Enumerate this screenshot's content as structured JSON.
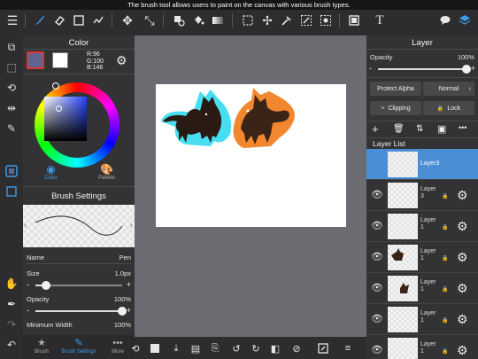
{
  "tooltip": "The brush tool allows users to paint on the canvas with various brush types.",
  "toolbar": {
    "tools": [
      "menu-icon",
      "brush-icon",
      "eraser-icon",
      "rectangle-select-icon",
      "blend-icon",
      "move-icon",
      "transform-icon",
      "fill-icon",
      "bucket-icon",
      "gradient-icon",
      "lasso-select-icon",
      "eyedropper-icon",
      "magic-wand-icon",
      "pen-select-icon",
      "text-icon",
      "speech-bubble-icon",
      "layers-icon"
    ]
  },
  "color_panel": {
    "title": "Color",
    "r": "R:96",
    "g": "G:100",
    "b": "B:146",
    "fg_color": "#606492",
    "bg_color": "#ffffff",
    "tab_color": "Color",
    "tab_palette": "Palette"
  },
  "brush_settings": {
    "title": "Brush Settings",
    "name_label": "Name",
    "name_value": "Pen",
    "size_label": "Size",
    "size_value": "1.0px",
    "size_fraction": 0.12,
    "opacity_label": "Opacity",
    "opacity_value": "100%",
    "opacity_fraction": 1.0,
    "minwidth_label": "Minimum Width",
    "minwidth_value": "100%"
  },
  "bottom_tabs": {
    "brush": "Brush",
    "brush_settings": "Brush Settings",
    "more": "More"
  },
  "layer_panel": {
    "title": "Layer",
    "opacity_label": "Opacity",
    "opacity_value": "100%",
    "opacity_fraction": 1.0,
    "protect_alpha": "Protect Alpha",
    "blend_mode": "Normal",
    "clipping": "Clipping",
    "lock": "Lock",
    "list_title": "Layer List",
    "layers": [
      {
        "name": "Layer3",
        "selected": true
      },
      {
        "name": "Layer 3",
        "selected": false
      },
      {
        "name": "Layer 1",
        "selected": false
      },
      {
        "name": "Layer 1",
        "selected": false
      },
      {
        "name": "Layer 1",
        "selected": false
      },
      {
        "name": "Layer 1",
        "selected": false
      },
      {
        "name": "Layer 1",
        "selected": false
      }
    ]
  },
  "accent_color": "#3d9be9"
}
